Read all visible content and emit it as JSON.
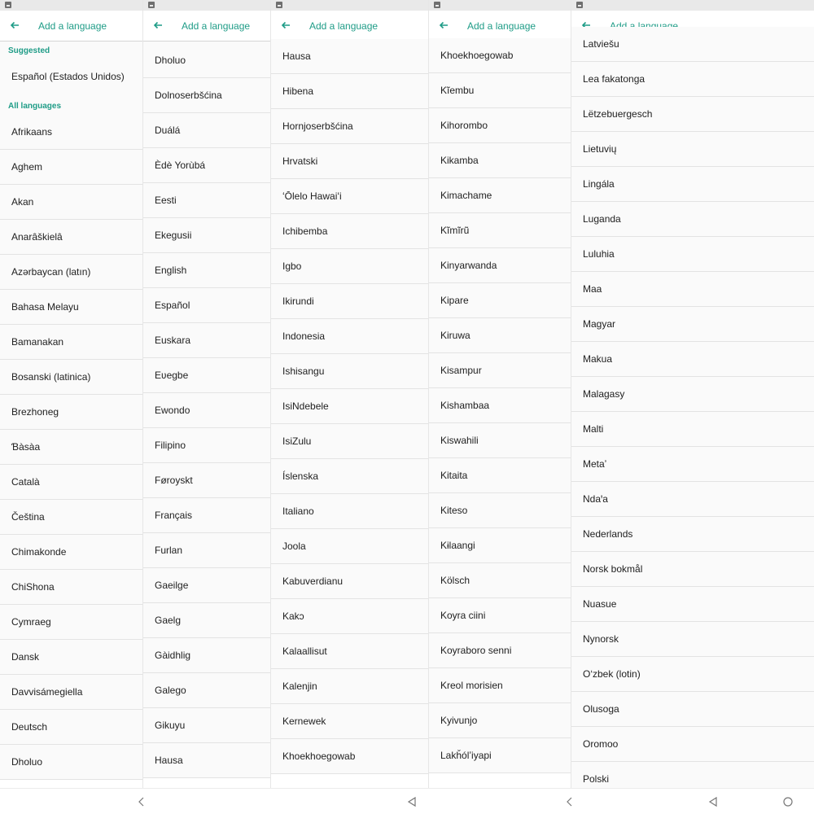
{
  "app_bar": {
    "title": "Add a language"
  },
  "panels": [
    {
      "suggested_header": "Suggested",
      "suggested": [
        "Español (Estados Unidos)"
      ],
      "all_header": "All languages",
      "items": [
        "Afrikaans",
        "Aghem",
        "Akan",
        "Anarâškielâ",
        "Azərbaycan (latın)",
        "Bahasa Melayu",
        "Bamanakan",
        "Bosanski (latinica)",
        "Brezhoneg",
        "Ɓàsàa",
        "Català",
        "Čeština",
        "Chimakonde",
        "ChiShona",
        "Cymraeg",
        "Dansk",
        "Davvisámegiella",
        "Deutsch",
        "Dholuo"
      ]
    },
    {
      "items": [
        "Dholuo",
        "Dolnoserbšćina",
        "Duálá",
        "Èdè Yorùbá",
        "Eesti",
        "Ekegusii",
        "English",
        "Español",
        "Euskara",
        "Eʋegbe",
        "Ewondo",
        "Filipino",
        "Føroyskt",
        "Français",
        "Furlan",
        "Gaeilge",
        "Gaelg",
        "Gàidhlig",
        "Galego",
        "Gikuyu",
        "Hausa"
      ]
    },
    {
      "items": [
        "Hausa",
        "Hibena",
        "Hornjoserbšćina",
        "Hrvatski",
        "ʻŌlelo Hawaiʻi",
        "Ichibemba",
        "Igbo",
        "Ikirundi",
        "Indonesia",
        "Ishisangu",
        "IsiNdebele",
        "IsiZulu",
        "Íslenska",
        "Italiano",
        "Joola",
        "Kabuverdianu",
        "Kakɔ",
        "Kalaallisut",
        "Kalenjin",
        "Kernewek",
        "Khoekhoegowab"
      ]
    },
    {
      "items": [
        "Khoekhoegowab",
        "Kĩembu",
        "Kihorombo",
        "Kikamba",
        "Kimachame",
        "Kĩmĩrũ",
        "Kinyarwanda",
        "Kipare",
        "Kiruwa",
        "Kisampur",
        "Kishambaa",
        "Kiswahili",
        "Kitaita",
        "Kiteso",
        "Kɨlaangi",
        "Kölsch",
        "Koyra ciini",
        "Koyraboro senni",
        "Kreol morisien",
        "Kyivunjo",
        "Lakȟólʼiyapi"
      ]
    },
    {
      "items": [
        "Latviešu",
        "Lea fakatonga",
        "Lëtzebuergesch",
        "Lietuvių",
        "Lingála",
        "Luganda",
        "Luluhia",
        "Maa",
        "Magyar",
        "Makua",
        "Malagasy",
        "Malti",
        "Metaʼ",
        "Ndaꞌa",
        "Nederlands",
        "Norsk bokmål",
        "Nuasue",
        "Nynorsk",
        "O‘zbek (lotin)",
        "Olusoga",
        "Oromoo",
        "Polski"
      ]
    }
  ],
  "nav_bar": {
    "back_glyphs": [
      "<",
      "◁",
      "<",
      "◁"
    ],
    "home_glyph": "○"
  },
  "colors": {
    "accent": "#1f9c87",
    "text": "#212121",
    "divider": "#e3e3e3",
    "status_bar": "#e9e9e9"
  }
}
